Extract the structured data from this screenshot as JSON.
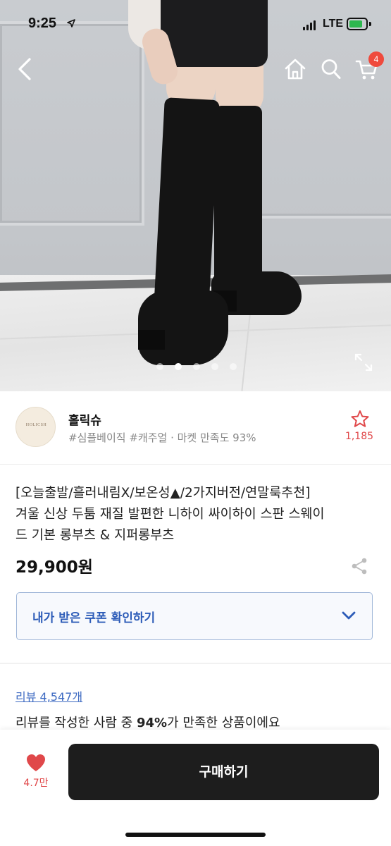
{
  "status_bar": {
    "time": "9:25",
    "network": "LTE"
  },
  "nav": {
    "cart_count": "4"
  },
  "gallery": {
    "total_images": 5,
    "active_index": 1
  },
  "store": {
    "logo_text": "HOLICSH",
    "name": "홀릭슈",
    "tags": "#심플베이직 #캐주얼 · 마켓 만족도 93%",
    "favorite_count": "1,185"
  },
  "product": {
    "title_lines": [
      "[오늘출발/흘러내림X/보온성▲/2가지버전/연말룩추천]",
      "겨울 신상 두툼 재질 발편한 니하이 싸이하이 스판 스웨이",
      "드 기본 롱부츠 & 지퍼롱부츠"
    ],
    "price": "29,900원",
    "coupon_label": "내가 받은 쿠폰 확인하기"
  },
  "review": {
    "link": "리뷰 4,547개",
    "summary_prefix": "리뷰를 작성한 사람 중 ",
    "summary_percent": "94%",
    "summary_suffix": "가 만족한 상품이에요"
  },
  "bottom": {
    "like_count": "4.7만",
    "buy_label": "구매하기"
  },
  "colors": {
    "accent_red": "#ef4a3d",
    "link_blue": "#3d6ac2",
    "coupon_blue": "#2d5cb8",
    "buy_button": "#1d1d1d"
  },
  "icons": [
    "back-icon",
    "home-icon",
    "search-icon",
    "cart-icon",
    "expand-icon",
    "star-icon",
    "share-icon",
    "chevron-down-icon",
    "heart-icon"
  ]
}
